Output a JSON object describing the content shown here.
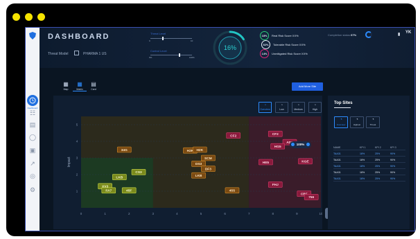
{
  "app": {
    "title": "DASHBOARD",
    "threat_model_label": "Threat Model",
    "threat_model_value": "PHARMA 1 US",
    "avatar_initials": "YK",
    "completion_label": "Completion status",
    "completion_value": "67%"
  },
  "sidebar": {
    "active_label": "Dashboard",
    "items": [
      "dashboard",
      "hierarchy",
      "document",
      "shield",
      "list",
      "connection",
      "target",
      "settings"
    ]
  },
  "levels": {
    "threat_label": "Threat Level",
    "threat_min": "0",
    "threat_max": "10",
    "threat_value": 0.3,
    "control_label": "Control Level",
    "control_min": "0%",
    "control_max": "100%",
    "control_value": 0.7
  },
  "gauge": {
    "value": "16%",
    "fill": 0.16
  },
  "risk_scores": [
    {
      "pct": "18%",
      "label": "Real Risk Score XX%",
      "color": "#2bd07c"
    },
    {
      "pct": "52%",
      "label": "Tolerable Risk Score XX%",
      "color": "#e8eef8"
    },
    {
      "pct": "14%",
      "label": "Unmitigated Risk Score XX%",
      "color": "#e0247a"
    }
  ],
  "view_tabs": [
    {
      "label": "Map",
      "icon": "map-icon"
    },
    {
      "label": "Matrix",
      "icon": "grid-icon",
      "active": true
    },
    {
      "label": "Card",
      "icon": "card-icon"
    }
  ],
  "add_button": "Add More Site",
  "filters": [
    {
      "label": "Overview",
      "active": true
    },
    {
      "label": "Low"
    },
    {
      "label": "Medium"
    },
    {
      "label": "High"
    }
  ],
  "zoom": "100%",
  "chart_data": {
    "type": "scatter",
    "title": "",
    "xlabel": "",
    "ylabel": "Impact",
    "xlim": [
      0,
      10
    ],
    "ylim": [
      0,
      5.5
    ],
    "x_ticks": [
      "0",
      "1",
      "2",
      "3",
      "4",
      "5",
      "6",
      "7",
      "8",
      "9",
      "10"
    ],
    "y_ticks": [
      "1",
      "2",
      "3",
      "4",
      "5"
    ],
    "zones": [
      {
        "name": "low",
        "x": [
          0,
          3
        ],
        "y": [
          0,
          3
        ],
        "color": "#1c3a22"
      },
      {
        "name": "medium",
        "x": [
          0,
          7
        ],
        "y": [
          0,
          5.5
        ],
        "color": "#2c2a1c"
      },
      {
        "name": "high",
        "x": [
          7,
          10
        ],
        "y": [
          0,
          5.5
        ],
        "color": "#3a1c2a"
      }
    ],
    "points": [
      {
        "label": "34G",
        "x": 1.8,
        "y": 3.5,
        "level": "medium"
      },
      {
        "label": "CS3",
        "x": 2.4,
        "y": 2.15,
        "level": "low"
      },
      {
        "label": "LKB",
        "x": 1.6,
        "y": 1.85,
        "level": "low"
      },
      {
        "label": "XV3",
        "x": 1.0,
        "y": 1.3,
        "level": "low"
      },
      {
        "label": "FA7",
        "x": 1.15,
        "y": 1.05,
        "level": "low"
      },
      {
        "label": "45F",
        "x": 2.0,
        "y": 1.05,
        "level": "low"
      },
      {
        "label": "H2K",
        "x": 4.55,
        "y": 3.45,
        "level": "medium"
      },
      {
        "label": "H2K",
        "x": 4.95,
        "y": 3.5,
        "level": "medium"
      },
      {
        "label": "SCM",
        "x": 5.3,
        "y": 3.0,
        "level": "medium"
      },
      {
        "label": "DS3",
        "x": 4.9,
        "y": 2.65,
        "level": "medium"
      },
      {
        "label": "DF3",
        "x": 5.3,
        "y": 2.35,
        "level": "medium"
      },
      {
        "label": "LKB",
        "x": 4.9,
        "y": 1.95,
        "level": "medium"
      },
      {
        "label": "45S",
        "x": 6.3,
        "y": 1.05,
        "level": "medium"
      },
      {
        "label": "CF2",
        "x": 6.35,
        "y": 4.35,
        "level": "high"
      },
      {
        "label": "CF2",
        "x": 8.1,
        "y": 4.45,
        "level": "high"
      },
      {
        "label": "AD2",
        "x": 8.7,
        "y": 3.95,
        "level": "high"
      },
      {
        "label": "HG5",
        "x": 8.2,
        "y": 3.7,
        "level": "high"
      },
      {
        "label": "HE5",
        "x": 7.7,
        "y": 2.75,
        "level": "high"
      },
      {
        "label": "KGE",
        "x": 9.35,
        "y": 2.8,
        "level": "high"
      },
      {
        "label": "FHJ",
        "x": 8.1,
        "y": 1.4,
        "level": "high"
      },
      {
        "label": "CBF",
        "x": 9.3,
        "y": 0.85,
        "level": "high"
      },
      {
        "label": "756",
        "x": 9.6,
        "y": 0.65,
        "level": "high"
      }
    ]
  },
  "top_sites": {
    "title": "Top Sites",
    "tabs": [
      {
        "label": "Overview",
        "active": true
      },
      {
        "label": "Highest"
      },
      {
        "label": "Threat"
      }
    ],
    "headers": [
      "NAME",
      "KPI 1",
      "KPI 2",
      "KPI 3"
    ],
    "rows": [
      {
        "name": "TAA31",
        "kpi1": "18%",
        "kpi2": "25%",
        "kpi3": "90%",
        "hl": true
      },
      {
        "name": "TAA31",
        "kpi1": "18%",
        "kpi2": "25%",
        "kpi3": "90%",
        "hl": false
      },
      {
        "name": "TAA31",
        "kpi1": "18%",
        "kpi2": "25%",
        "kpi3": "90%",
        "hl": true
      },
      {
        "name": "TAA31",
        "kpi1": "18%",
        "kpi2": "25%",
        "kpi3": "90%",
        "hl": false
      },
      {
        "name": "TAA31",
        "kpi1": "18%",
        "kpi2": "25%",
        "kpi3": "90%",
        "hl": true
      }
    ]
  }
}
